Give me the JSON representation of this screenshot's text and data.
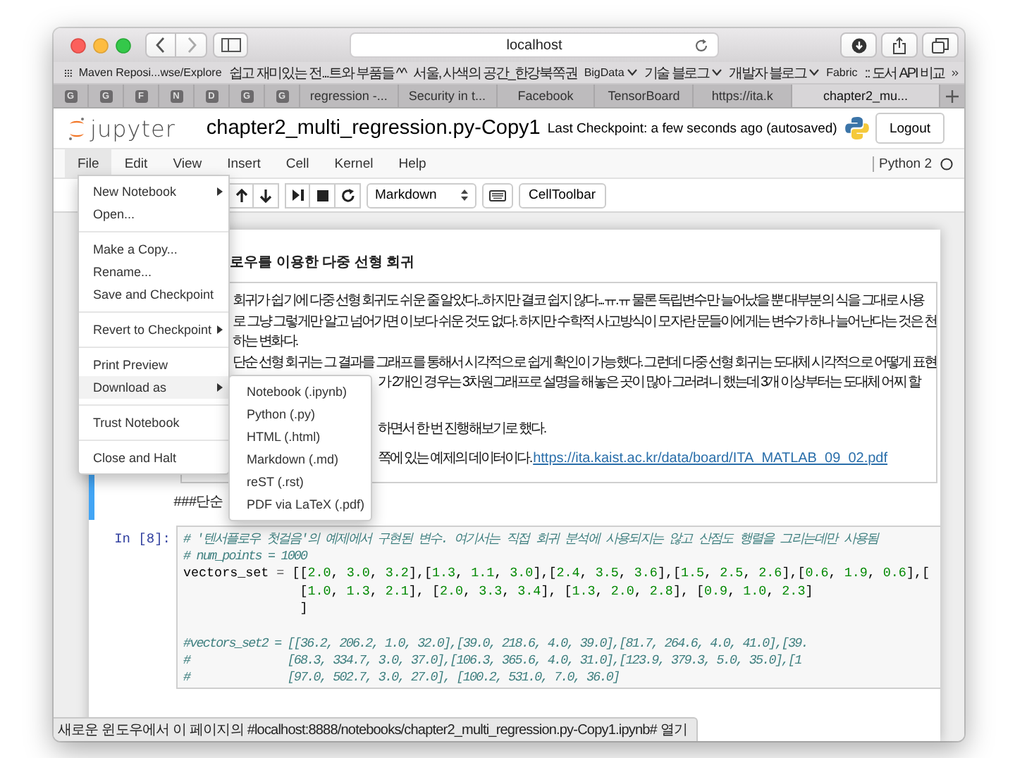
{
  "browser": {
    "address": "localhost",
    "bookmarks": [
      {
        "label": "Maven Reposi...wse/Explore",
        "dropdown": false
      },
      {
        "label": "쉽고 재미있는 전...트와 부품들 ^^",
        "dropdown": false
      },
      {
        "label": "서울, 사색의 공간_한강북쪽권",
        "dropdown": false
      },
      {
        "label": "BigData",
        "dropdown": true
      },
      {
        "label": "기술 블로그",
        "dropdown": true
      },
      {
        "label": "개발자 블로그",
        "dropdown": true
      },
      {
        "label": "Fabric",
        "dropdown": false
      },
      {
        "label": ":: 도서 API 비교",
        "dropdown": false
      }
    ],
    "pinned_tabs": [
      "G",
      "G",
      "F",
      "N",
      "D",
      "G",
      "G"
    ],
    "tabs": [
      {
        "title": "regression -...",
        "selected": false
      },
      {
        "title": "Security in t...",
        "selected": false
      },
      {
        "title": "Facebook",
        "selected": false
      },
      {
        "title": "TensorBoard",
        "selected": false
      },
      {
        "title": "https://ita.k",
        "selected": false
      },
      {
        "title": "chapter2_mu...",
        "selected": true
      }
    ]
  },
  "notebook": {
    "logo": "jupyter",
    "title": "chapter2_multi_regression.py-Copy1",
    "checkpoint": "Last Checkpoint: a few seconds ago (autosaved)",
    "logout": "Logout",
    "menu": [
      {
        "label": "File",
        "selected": true
      },
      {
        "label": "Edit",
        "selected": false
      },
      {
        "label": "View",
        "selected": false
      },
      {
        "label": "Insert",
        "selected": false
      },
      {
        "label": "Cell",
        "selected": false
      },
      {
        "label": "Kernel",
        "selected": false
      },
      {
        "label": "Help",
        "selected": false
      }
    ],
    "kernel": "Python 2",
    "cell_type": "Markdown",
    "cell_toolbar": "CellToolbar",
    "markdown_cell": {
      "heading": "로우를 이용한 다중 선형 회귀",
      "lines_beside_menu": [
        "회귀가 쉽기에 다중 선형 회귀도 쉬운 줄 알았다...하지만 결코 쉽지 않다...ㅠ.ㅠ 물론 독립변수만 늘어났을 뿐 대부분의 식을 그대로 사용",
        "로 그냥 그렇게만 알고 넘어가면 이보다 쉬운 것도 없다. 하지만 수학적 사고방식이 모자란 문들이에게는 변수가 하나 늘어난다는 것은 천",
        "하는 변화다.",
        "단순 선형 회귀는 그 결과를 그래프를 통해서 시각적으로 쉽게 확인이 가능했다. 그런데 다중 선형 회귀는 도대체 시각적으로 어떻게 표현"
      ],
      "lines_beside_submenu": [
        {
          "text": "가 2개인 경우는 3차원그래프로 설명을 해놓은 곳이 많아 그러려니 했는데 3개 이상부터는 도대체 어찌 할"
        },
        {
          "text": "하면서 한 번 진행해보기로 했다."
        },
        {
          "text": "쪽에 있는 예제의 데이터이다.",
          "link": "https://ita.kaist.ac.kr/data/board/ITA_MATLAB_09_02.pdf"
        }
      ],
      "source_line": "###단순"
    },
    "code_cell": {
      "prompt": "In [8]:",
      "blocks": [
        [
          {
            "kind": "comment",
            "text": "# '텐서플로우 첫걸음'의 예제에서 구현된 변수. 여기서는 직접 회귀 분석에 사용되지는 않고 산점도 행렬을 그리는데만 사용됨"
          },
          {
            "kind": "comment",
            "text": "# num_points = 1000"
          },
          {
            "kind": "code",
            "text": "vectors_set = [[2.0, 3.0, 3.2],[1.3, 1.1, 3.0],[2.4, 3.5, 3.6],[1.5, 2.5, 2.6],[0.6, 1.9, 0.6],["
          },
          {
            "kind": "code",
            "text": "               [1.0, 1.3, 2.1], [2.0, 3.3, 3.4], [1.3, 2.0, 2.8], [0.9, 1.0, 2.3]"
          },
          {
            "kind": "code",
            "text": "               ]"
          }
        ],
        [
          {
            "kind": "comment",
            "text": "#vectors_set2 = [[36.2, 206.2, 1.0, 32.0],[39.0, 218.6, 4.0, 39.0],[81.7, 264.6, 4.0, 41.0],[39."
          },
          {
            "kind": "comment",
            "text": "#               [68.3, 334.7, 3.0, 37.0],[106.3, 365.6, 4.0, 31.0],[123.9, 379.3, 5.0, 35.0],[1"
          },
          {
            "kind": "comment",
            "text": "#               [97.0, 502.7, 3.0, 27.0], [100.2, 531.0, 7.0, 36.0]"
          }
        ]
      ]
    }
  },
  "file_menu": [
    [
      {
        "label": "New Notebook",
        "submenu": true,
        "selected": false
      },
      {
        "label": "Open...",
        "submenu": false,
        "selected": false
      }
    ],
    [
      {
        "label": "Make a Copy...",
        "submenu": false,
        "selected": false
      },
      {
        "label": "Rename...",
        "submenu": false,
        "selected": false
      },
      {
        "label": "Save and Checkpoint",
        "submenu": false,
        "selected": false
      }
    ],
    [
      {
        "label": "Revert to Checkpoint",
        "submenu": true,
        "selected": false
      }
    ],
    [
      {
        "label": "Print Preview",
        "submenu": false,
        "selected": false
      },
      {
        "label": "Download as",
        "submenu": true,
        "selected": true
      }
    ],
    [
      {
        "label": "Trust Notebook",
        "submenu": false,
        "selected": false
      }
    ],
    [
      {
        "label": "Close and Halt",
        "submenu": false,
        "selected": false
      }
    ]
  ],
  "download_submenu": [
    "Notebook (.ipynb)",
    "Python (.py)",
    "HTML (.html)",
    "Markdown (.md)",
    "reST (.rst)",
    "PDF via LaTeX (.pdf)"
  ],
  "status_bar": "새로운 윈도우에서 이 페이지의 #localhost:8888/notebooks/chapter2_multi_regression.py-Copy1.ipynb# 열기"
}
